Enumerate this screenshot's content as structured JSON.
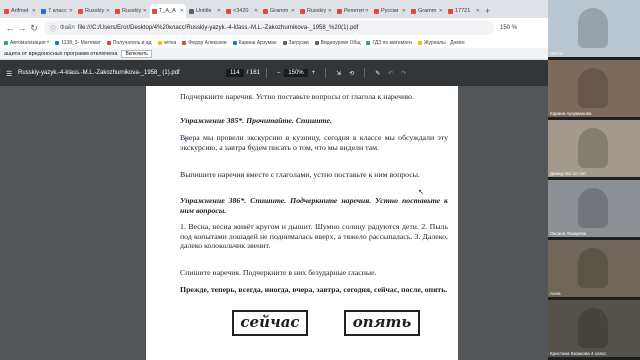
{
  "browser": {
    "tabs": [
      {
        "label": "Arifmet",
        "color": "#e8453c"
      },
      {
        "label": "7 класс",
        "color": "#1a73e8"
      },
      {
        "label": "Russkiy",
        "color": "#e8453c"
      },
      {
        "label": "Russkiy",
        "color": "#e8453c"
      },
      {
        "label": "T_A_A",
        "color": "#e8453c"
      },
      {
        "label": "Untitle",
        "color": "#5f6368"
      },
      {
        "label": "<3420",
        "color": "#e8453c"
      },
      {
        "label": "Gramm",
        "color": "#e8453c"
      },
      {
        "label": "Russkiy",
        "color": "#e8453c"
      },
      {
        "label": "Репетит",
        "color": "#e8453c"
      },
      {
        "label": "Русски",
        "color": "#e8453c"
      },
      {
        "label": "Gramm",
        "color": "#e8453c"
      },
      {
        "label": "17721",
        "color": "#e8453c"
      }
    ],
    "url": "file:///C:/Users/Eror/Desktop/4%20класс/Russkiy-yazyk.-4-klass.-M.L.-Zakozhurnikova-_1958_%20(1).pdf",
    "url_prefix": "Файл",
    "zoom": "150 %",
    "bookmarks": [
      {
        "label": "Автоматизация т",
        "color": "#34a853"
      },
      {
        "label": "1138_3- Математ",
        "color": "#1a73e8"
      },
      {
        "label": "Получатель и ад",
        "color": "#ea4335"
      },
      {
        "label": "чётка",
        "color": "#fbbc04"
      },
      {
        "label": "Федор Алексеев",
        "color": "#ea4335"
      },
      {
        "label": "Карина Арзуман",
        "color": "#1a73e8"
      },
      {
        "label": "Загрузки",
        "color": "#5f6368"
      },
      {
        "label": "Видеоуроки Общ",
        "color": "#5f6368"
      },
      {
        "label": "ГДЗ по математи",
        "color": "#34a853"
      },
      {
        "label": "Журналы · Дневн",
        "color": "#fbbc04"
      }
    ],
    "infobar_text": "ащита от вредоносных программ отключена",
    "infobar_button": "Включить"
  },
  "pdf": {
    "filename": "Russkiy-yazyk.-4-klass.-M.L.-Zakozhurnikova-_1958_ (1).pdf",
    "page_current": "114",
    "page_total": "/ 161",
    "zoom": "150%",
    "paragraphs": [
      "Подчеркните наречия. Устно поставьте вопросы от глагола к наречию.",
      "Упражнение 385*. Прочитайте. Спишите.",
      "Вчера мы провели экскурсию в кузницу, сегодня в классе мы обсуждали эту экскурсию, а завтра будем писать о том, что мы видели там.",
      "Выпишите наречия вместе с глаголами, устно поставьте к ним вопросы.",
      "Упражнение 386*. Спишите. Подчеркните наречия. Устно поставьте к ним вопросы.",
      "1. Весна, весна живёт кругом и дышит. Шумно солнцу радуются дети. 2. Пыль под копытами лошадей не поднималась вверх, а тяжело рассыпалась. 3. Далеко, далеко колокольчик звенит.",
      "Спишите наречия. Подчеркните в них безударные гласные.",
      "Прежде, теперь, всегда, иногда, вчера, завтра, сегодня, сейчас, после, опять."
    ],
    "boxed_words": [
      "сейчас",
      "опять"
    ]
  },
  "call": {
    "participants": [
      {
        "name": "Настя",
        "bg": "#b9c6cf"
      },
      {
        "name": "Карина Арзуманова",
        "bg": "#7e6a5a"
      },
      {
        "name": "Давид 4кл 10 лет",
        "bg": "#a29a8c"
      },
      {
        "name": "Оксана Лазарева",
        "bg": "#8c8f94"
      },
      {
        "name": "Анна",
        "bg": "#6e6658"
      },
      {
        "name": "Кристина Казакова 4 класс",
        "bg": "#55524b"
      }
    ]
  }
}
